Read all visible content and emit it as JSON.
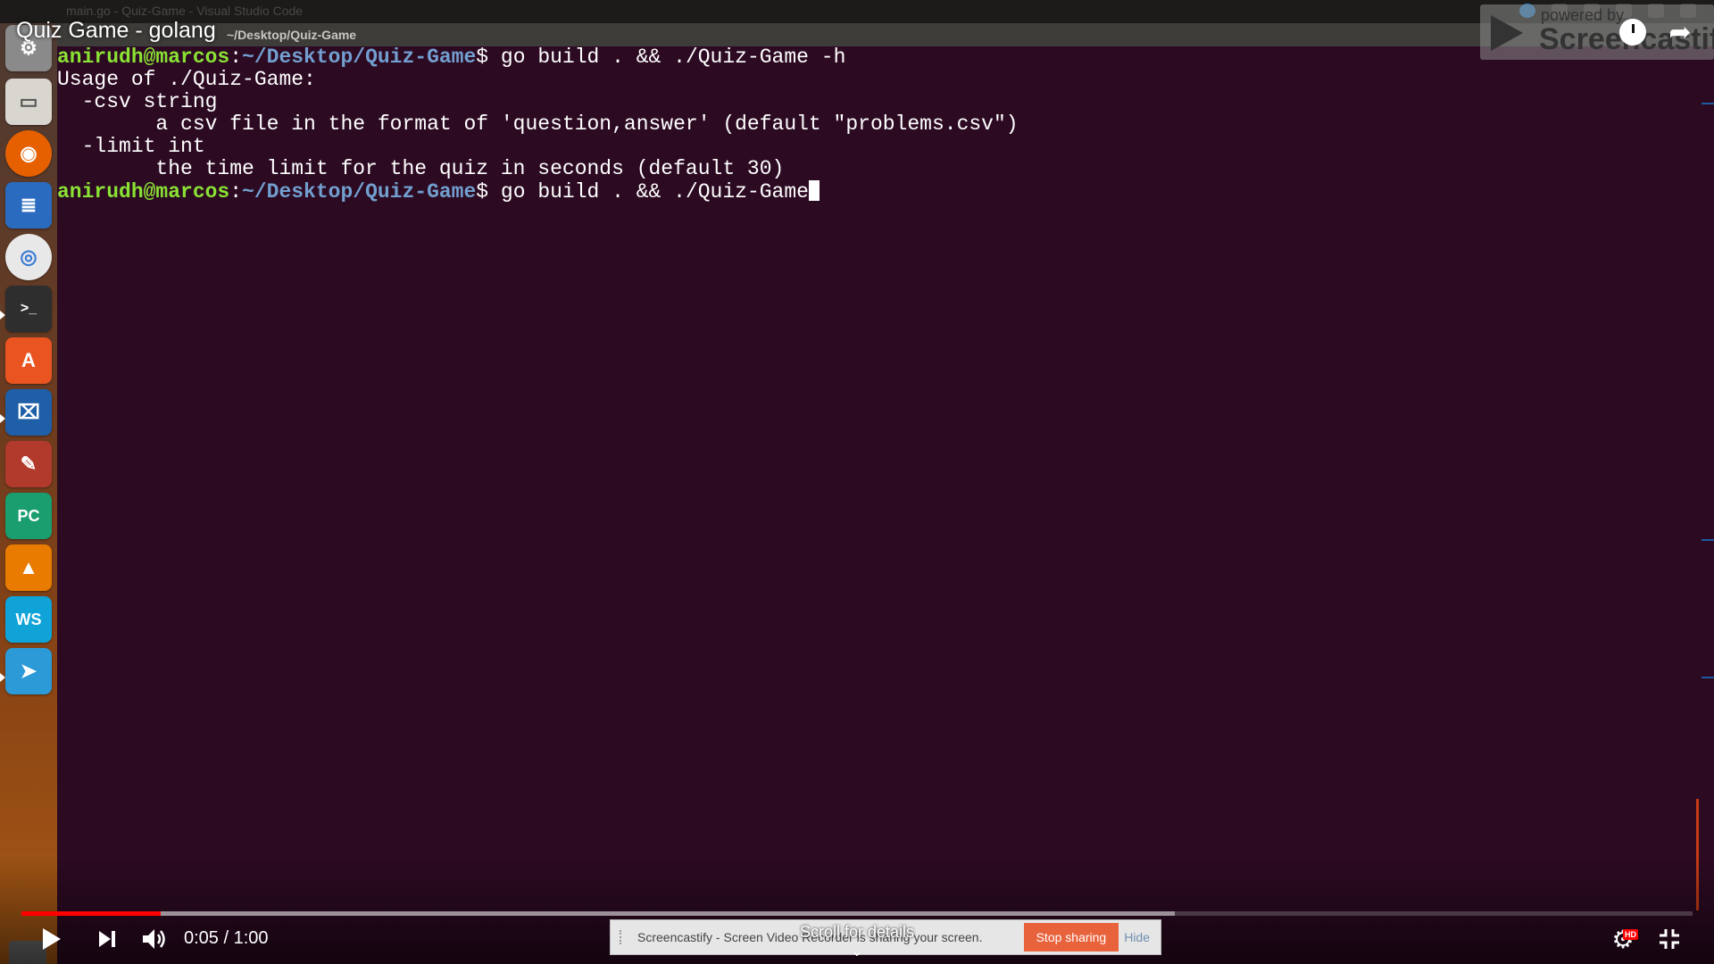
{
  "video": {
    "title": "Quiz Game - golang",
    "time_current": "0:05",
    "time_total": "1:00",
    "time_display": "0:05 / 1:00",
    "progress": 0.0833,
    "buffered": 0.69,
    "scroll_hint": "Scroll for details"
  },
  "desktop": {
    "window_title": "main.go - Quiz-Game - Visual Studio Code",
    "terminal_title": "~/Desktop/Quiz-Game"
  },
  "terminal": {
    "prompt_user": "anirudh@marcos",
    "prompt_path": "~/Desktop/Quiz-Game",
    "prompt_symbol": "$",
    "command1": " go build . && ./Quiz-Game -h",
    "output": [
      "Usage of ./Quiz-Game:",
      "  -csv string",
      "        a csv file in the format of 'question,answer' (default \"problems.csv\")",
      "  -limit int",
      "        the time limit for the quiz in seconds (default 30)"
    ],
    "command2": " go build . && ./Quiz-Game"
  },
  "screencastify": {
    "powered_by": "powered by",
    "brand": "Screencastify",
    "share_text": "Screencastify - Screen Video Recorder is sharing your screen.",
    "stop_label": "Stop sharing",
    "hide_label": "Hide"
  },
  "colors": {
    "terminal_bg": "#2c0a22",
    "prompt_user": "#8ae234",
    "prompt_path": "#729fcf",
    "progress": "#ff0000"
  },
  "launcher_icons": [
    "settings-icon",
    "files-icon",
    "firefox-icon",
    "writer-icon",
    "chrome-icon",
    "terminal-icon",
    "software-center-icon",
    "vscode-icon",
    "tools-icon",
    "pycharm-icon",
    "vlc-icon",
    "webstorm-icon",
    "telegram-icon"
  ],
  "controls_icons": [
    "play-icon",
    "next-icon",
    "volume-icon",
    "settings-icon",
    "exit-fullscreen-icon",
    "watch-later-icon",
    "share-icon"
  ]
}
